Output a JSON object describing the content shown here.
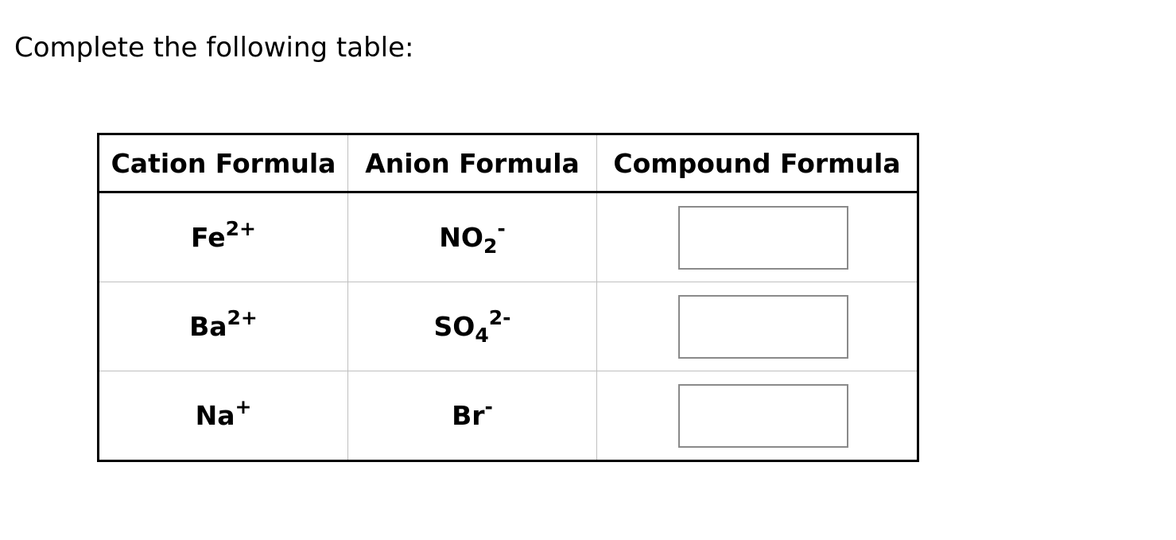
{
  "prompt": "Complete the following table:",
  "table": {
    "headers": [
      "Cation Formula",
      "Anion Formula",
      "Compound Formula"
    ],
    "rows": [
      {
        "cation": {
          "base": "Fe",
          "charge": "2+"
        },
        "anion": {
          "base": "NO",
          "sub": "2",
          "charge": "-"
        },
        "compound": ""
      },
      {
        "cation": {
          "base": "Ba",
          "charge": "2+"
        },
        "anion": {
          "base": "SO",
          "sub": "4",
          "charge": "2-"
        },
        "compound": ""
      },
      {
        "cation": {
          "base": "Na",
          "charge": "+"
        },
        "anion": {
          "base": "Br",
          "sub": "",
          "charge": "-"
        },
        "compound": ""
      }
    ]
  }
}
